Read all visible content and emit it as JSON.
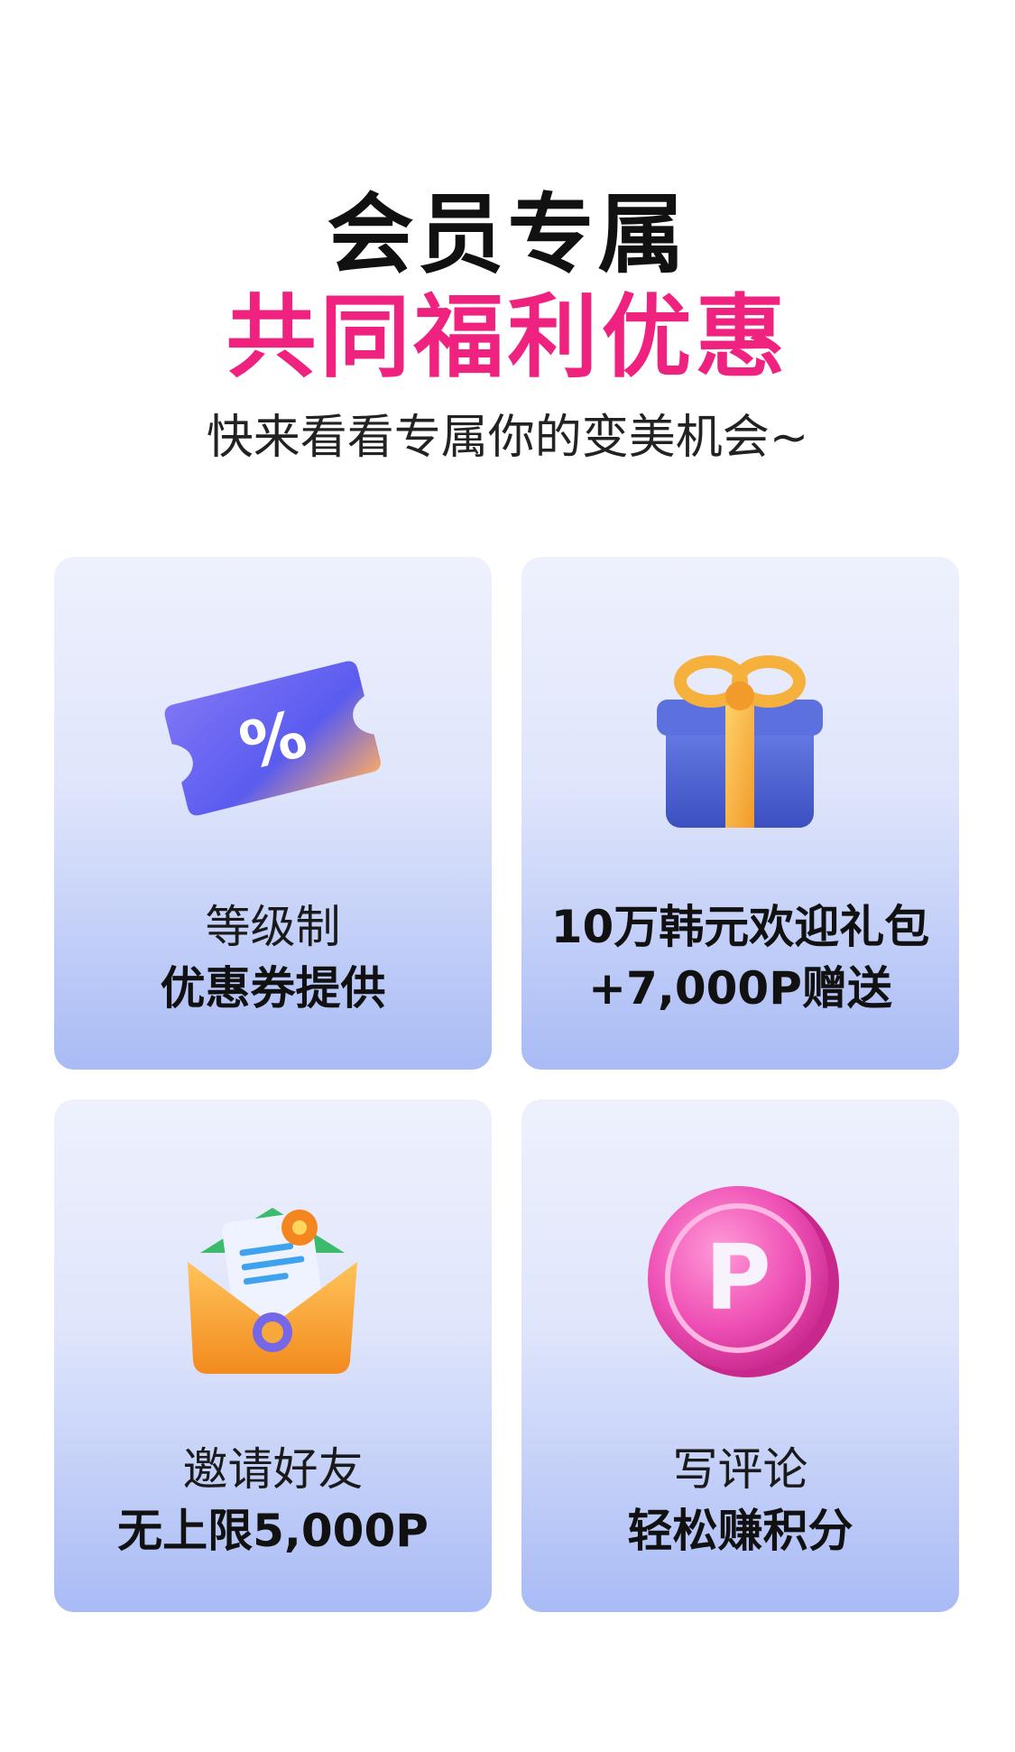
{
  "header": {
    "title_line1": "会员专属",
    "title_line2": "共同福利优惠",
    "subtitle": "快来看看专属你的变美机会~",
    "accent_color": "#f0227f"
  },
  "cards": [
    {
      "icon": "coupon-ticket-icon",
      "line1": "等级制",
      "line2": "优惠券提供"
    },
    {
      "icon": "gift-box-icon",
      "line1": "10万韩元欢迎礼包",
      "line2": "+7,000P赠送"
    },
    {
      "icon": "envelope-letter-icon",
      "line1": "邀请好友",
      "line2": "无上限5,000P"
    },
    {
      "icon": "points-coin-icon",
      "line1": "写评论",
      "line2": "轻松赚积分"
    }
  ]
}
